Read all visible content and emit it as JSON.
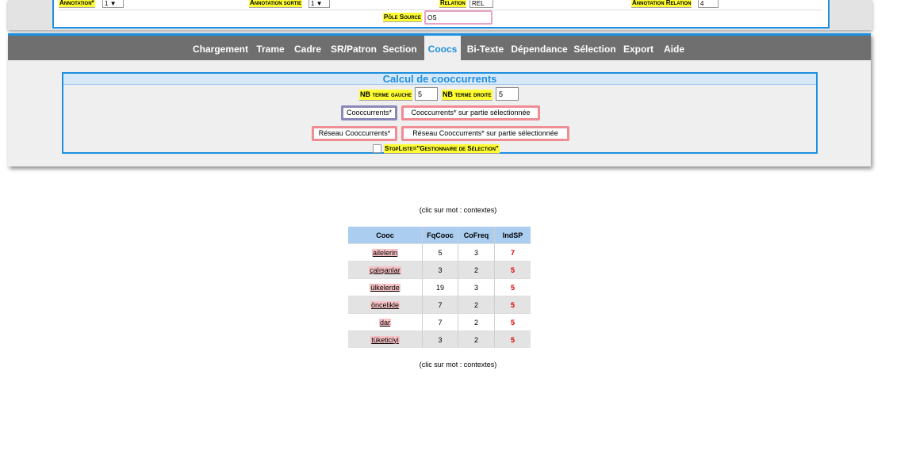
{
  "top_panel": {
    "annotation_label": "Annotation*",
    "annotation_value": "1 ▼",
    "annotation_sortie_label": "Annotation sortie",
    "annotation_sortie_value": "1 ▼",
    "relation_label": "Relation",
    "relation_value": "REL",
    "annotation_relation_label": "Annotation Relation",
    "annotation_relation_value": "4",
    "pole_source_label": "Pôle Source",
    "pole_source_value": "OS"
  },
  "tabs": [
    "Chargement",
    "Trame",
    "Cadre",
    "SR/Patron",
    "Section",
    "Coocs",
    "Bi-Texte",
    "Dépendance",
    "Sélection",
    "Export",
    "Aide"
  ],
  "active_tab": "Coocs",
  "cooc_panel": {
    "title": "Calcul de cooccurrents",
    "nb_gauche_label": "NB terme gauche",
    "nb_gauche_value": "5",
    "nb_droite_label": "NB terme droite",
    "nb_droite_value": "5",
    "btn_cooccurrents": "Cooccurrents*",
    "btn_cooccurrents_partie": "Cooccurrents* sur partie sélectionnée",
    "btn_reseau": "Réseau Cooccurrents*",
    "btn_reseau_partie": "Réseau Cooccurrents* sur partie sélectionnée",
    "stopliste_label": "StopListe=\"Gestionnaire de Sélection\""
  },
  "results": {
    "note_top": "(clic sur mot : contextes)",
    "note_bottom": "(clic sur mot : contextes)",
    "columns": [
      "Cooc",
      "FqCooc",
      "CoFreq",
      "IndSP"
    ],
    "rows": [
      [
        "ailelerin",
        "5",
        "3",
        "7"
      ],
      [
        "çalışanlar",
        "3",
        "2",
        "5"
      ],
      [
        "ülkelerde",
        "19",
        "3",
        "5"
      ],
      [
        "öncelikle",
        "7",
        "2",
        "5"
      ],
      [
        "dar",
        "7",
        "2",
        "5"
      ],
      [
        "tüketiciyi",
        "3",
        "2",
        "5"
      ]
    ]
  },
  "colors": {
    "accent": "#1e8fe0",
    "tabbar": "#6f6f6f",
    "highlight": "#ffff33",
    "button_border": "#f08c94",
    "indsp": "#e00000"
  }
}
